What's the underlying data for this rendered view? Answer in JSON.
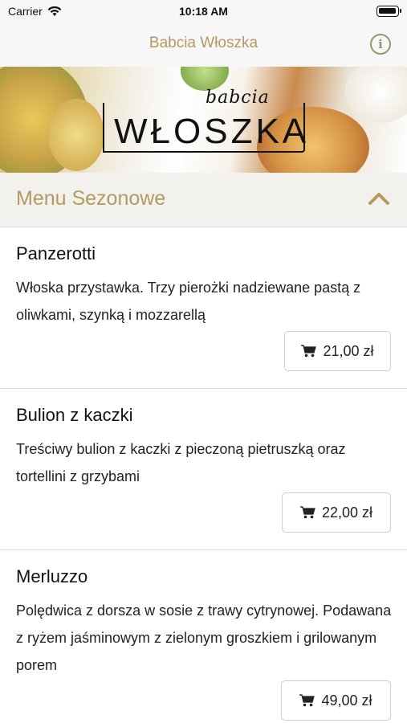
{
  "status_bar": {
    "carrier": "Carrier",
    "time": "10:18 AM"
  },
  "nav": {
    "title": "Babcia Włoszka",
    "info_icon": "info-icon"
  },
  "banner": {
    "logo_small": "babcia",
    "logo_big": "WŁOSZKA"
  },
  "section": {
    "title": "Menu Sezonowe",
    "toggle_icon": "chevron-up-icon"
  },
  "colors": {
    "accent": "#b59a5e",
    "info": "#8a9f69",
    "section_bg": "#f3f1ee"
  },
  "menu_items": [
    {
      "name": "Panzerotti",
      "description": "Włoska przystawka. Trzy pierożki nadziewane pastą z oliwkami, szynką i mozzarellą",
      "price": "21,00 zł"
    },
    {
      "name": "Bulion z kaczki",
      "description": "Treściwy bulion z kaczki z pieczoną pietruszką oraz tortellini z grzybami",
      "price": "22,00 zł"
    },
    {
      "name": "Merluzzo",
      "description": "Polędwica z dorsza w sosie z trawy cytrynowej. Podawana z ryżem jaśminowym z zielonym groszkiem i grilowanym porem",
      "price": "49,00 zł"
    }
  ]
}
